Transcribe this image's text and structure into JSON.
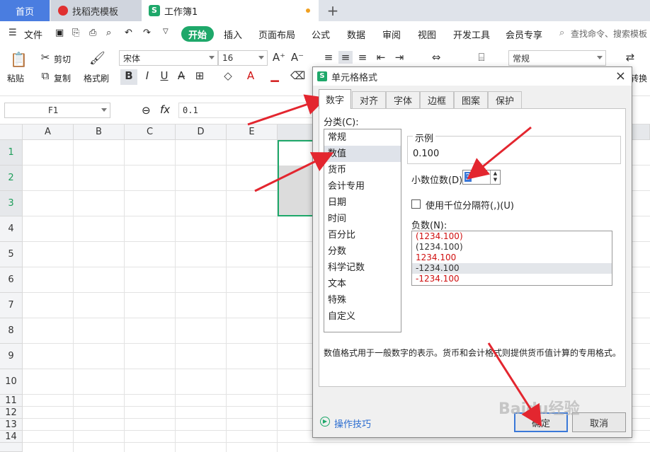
{
  "tabs": {
    "home": "首页",
    "template": "找稻壳模板",
    "workbook": "工作簿1",
    "add": "+"
  },
  "menu": {
    "file": "文件",
    "start": "开始",
    "insert": "插入",
    "layout": "页面布局",
    "formula": "公式",
    "data": "数据",
    "review": "审阅",
    "view": "视图",
    "devtools": "开发工具",
    "member": "会员专享",
    "search": "查找命令、搜索模板"
  },
  "ribbon": {
    "paste": "粘贴",
    "cut": "剪切",
    "copy": "复制",
    "painter": "格式刷",
    "font": "宋体",
    "size": "16",
    "number_format": "常规",
    "convert": "转换",
    "bold": "B",
    "italic": "I",
    "underline": "U"
  },
  "formula": {
    "cell_ref": "F1",
    "value": "0.1",
    "fx": "fx"
  },
  "columns": [
    "A",
    "B",
    "C",
    "D",
    "E"
  ],
  "rows": [
    "1",
    "2",
    "3",
    "4",
    "5",
    "6",
    "7",
    "8",
    "9",
    "10",
    "11",
    "12",
    "13",
    "14"
  ],
  "dialog": {
    "title": "单元格格式",
    "tabs": [
      "数字",
      "对齐",
      "字体",
      "边框",
      "图案",
      "保护"
    ],
    "category_label": "分类(C):",
    "categories": [
      "常规",
      "数值",
      "货币",
      "会计专用",
      "日期",
      "时间",
      "百分比",
      "分数",
      "科学记数",
      "文本",
      "特殊",
      "自定义"
    ],
    "sample_label": "示例",
    "sample_value": "0.100",
    "decimal_label": "小数位数(D):",
    "decimal_value": "3",
    "thousands_label": "使用千位分隔符(,)(U)",
    "negative_label": "负数(N):",
    "negatives": [
      "(1234.100)",
      "(1234.100)",
      "1234.100",
      "-1234.100",
      "-1234.100"
    ],
    "description": "数值格式用于一般数字的表示。货币和会计格式则提供货币值计算的专用格式。",
    "tips": "操作技巧",
    "ok": "确定",
    "cancel": "取消",
    "close": "×"
  },
  "watermark": "Baidu经验",
  "colors": {
    "accent_green": "#1ea86a",
    "tab_blue": "#4a7de0",
    "arrow_red": "#e3262f",
    "negative_red": "#d01010"
  }
}
